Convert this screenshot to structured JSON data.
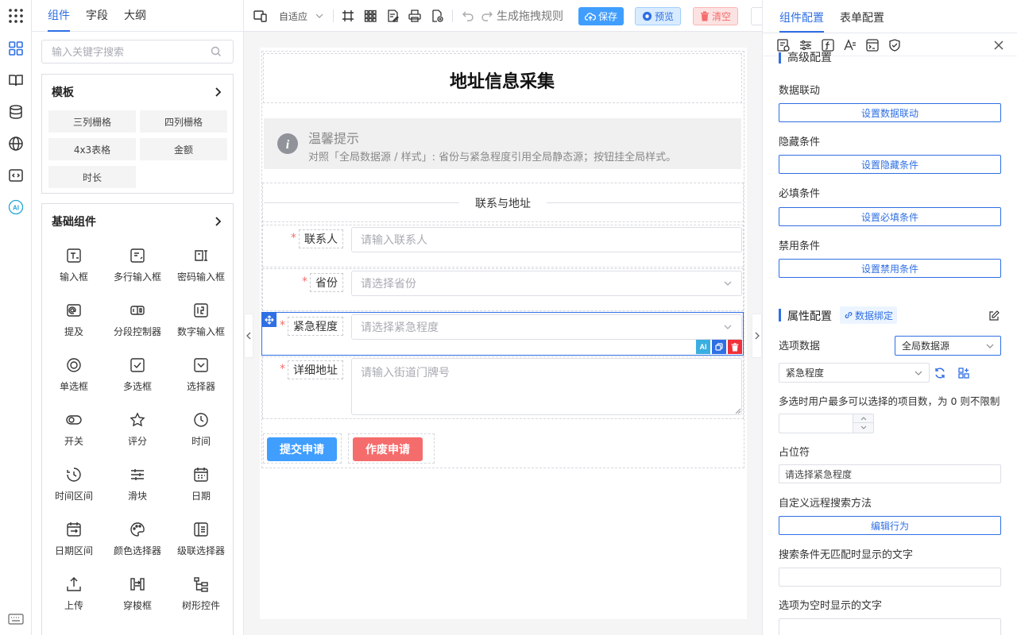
{
  "left_panel": {
    "tabs": [
      {
        "label": "组件"
      },
      {
        "label": "字段"
      },
      {
        "label": "大纲"
      }
    ],
    "search_placeholder": "输入关键字搜索",
    "templates_title": "模板",
    "templates": [
      "三列栅格",
      "四列栅格",
      "4x3表格",
      "金额",
      "时长"
    ],
    "basic_title": "基础组件",
    "components": [
      "输入框",
      "多行输入框",
      "密码输入框",
      "提及",
      "分段控制器",
      "数字输入框",
      "单选框",
      "多选框",
      "选择器",
      "开关",
      "评分",
      "时间",
      "时间区间",
      "滑块",
      "日期",
      "日期区间",
      "颜色选择器",
      "级联选择器",
      "上传",
      "穿梭框",
      "树形控件"
    ]
  },
  "toolbar": {
    "adaptive_label": "自适应",
    "generate_rules": "生成拖拽规则",
    "save": "保存",
    "preview": "预览",
    "clear": "清空"
  },
  "form": {
    "title": "地址信息采集",
    "alert_title": "温馨提示",
    "alert_text": "对照「全局数据源 / 样式」: 省份与紧急程度引用全局静态源；按钮挂全局样式。",
    "section_title": "联系与地址",
    "fields": [
      {
        "label": "联系人",
        "placeholder": "请输入联系人"
      },
      {
        "label": "省份",
        "placeholder": "请选择省份"
      },
      {
        "label": "紧急程度",
        "placeholder": "请选择紧急程度"
      },
      {
        "label": "详细地址",
        "placeholder": "请输入街道门牌号"
      }
    ],
    "submit_label": "提交申请",
    "void_label": "作废申请",
    "ai_badge": "AI"
  },
  "right_panel": {
    "tabs": [
      {
        "label": "组件配置"
      },
      {
        "label": "表单配置"
      }
    ],
    "advanced_title": "高级配置",
    "data_linkage_label": "数据联动",
    "data_linkage_btn": "设置数据联动",
    "hide_label": "隐藏条件",
    "hide_btn": "设置隐藏条件",
    "required_label": "必填条件",
    "required_btn": "设置必填条件",
    "disable_label": "禁用条件",
    "disable_btn": "设置禁用条件",
    "props_title": "属性配置",
    "data_binding": "数据绑定",
    "option_data_label": "选项数据",
    "option_source": "全局数据源",
    "option_value": "紧急程度",
    "multiple_limit_label": "多选时用户最多可以选择的项目数，为 0 则不限制",
    "placeholder_label": "占位符",
    "placeholder_value": "请选择紧急程度",
    "remote_label": "自定义远程搜索方法",
    "remote_btn": "编辑行为",
    "no_match_label": "搜索条件无匹配时显示的文字",
    "no_data_label": "选项为空时显示的文字"
  },
  "colors": {
    "primary": "#2f6fe4",
    "danger": "#f56c6c",
    "submit": "#409eff"
  }
}
